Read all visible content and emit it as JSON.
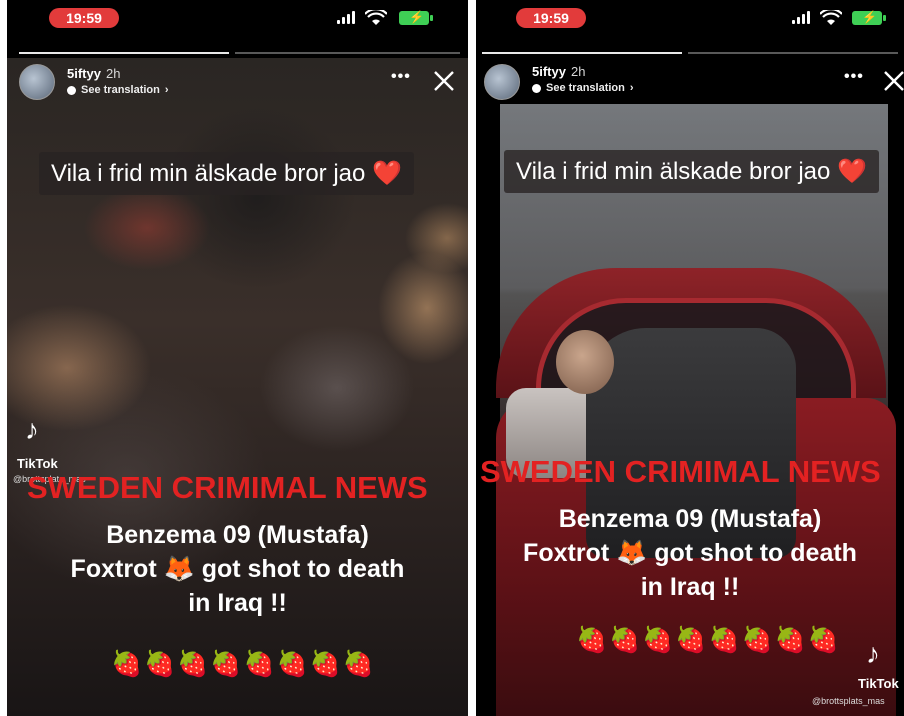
{
  "status_bar": {
    "time": "19:59"
  },
  "story": {
    "username": "5iftyy",
    "age": "2h",
    "see_translation": "See translation",
    "more_icon": "more-dots-icon",
    "close_icon": "close-icon",
    "caption": "Vila i frid min älskade bror jao",
    "caption_emoji": "❤️",
    "watermark": "SWEDEN CRIMIMAL NEWS",
    "line1": "Benzema 09 (Mustafa)",
    "line2_prefix": "Foxtrot",
    "line2_emoji": "🦊",
    "line2_suffix": "got shot to death",
    "line3": "in Iraq !!",
    "strawberries": "🍓🍓🍓🍓🍓🍓🍓🍓",
    "tiktok_name": "TikTok",
    "tiktok_handle_left": "@brottsplats_mas",
    "tiktok_handle_right": "@brottsplats_mas"
  },
  "colors": {
    "time_pill": "#e23b3b",
    "battery": "#3fcf55",
    "watermark": "#e32222"
  }
}
